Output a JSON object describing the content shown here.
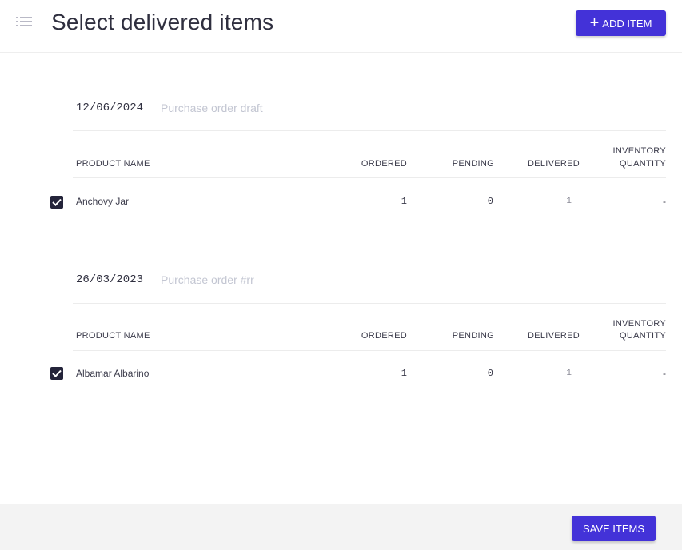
{
  "header": {
    "title": "Select delivered items",
    "add_item_label": "ADD ITEM",
    "menu_icon": "list-icon"
  },
  "columns": {
    "product_name": "PRODUCT NAME",
    "ordered": "ORDERED",
    "pending": "PENDING",
    "delivered": "DELIVERED",
    "inventory_line1": "INVENTORY",
    "inventory_line2": "QUANTITY"
  },
  "orders": [
    {
      "date": "12/06/2024",
      "name": "Purchase order draft",
      "items": [
        {
          "checked": true,
          "product": "Anchovy Jar",
          "ordered": "1",
          "pending": "0",
          "delivered": "1",
          "inventory": "-"
        }
      ]
    },
    {
      "date": "26/03/2023",
      "name": "Purchase order #rr",
      "items": [
        {
          "checked": true,
          "product": "Albamar Albarino",
          "ordered": "1",
          "pending": "0",
          "delivered": "1",
          "inventory": "-"
        }
      ]
    }
  ],
  "footer": {
    "save_label": "SAVE ITEMS"
  },
  "colors": {
    "accent": "#4332d8",
    "checkbox": "#24243a",
    "muted_text": "#c3c6d2"
  }
}
